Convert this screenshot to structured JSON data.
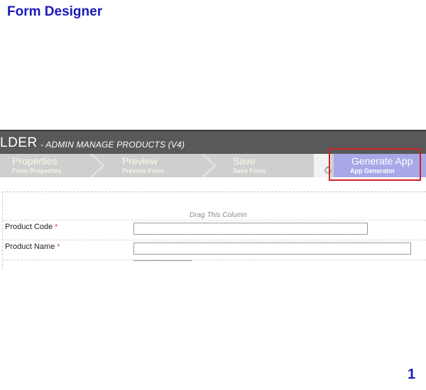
{
  "page": {
    "title": "Form Designer",
    "page_number": "1"
  },
  "builder": {
    "header_main": "LDER",
    "header_sub": "- ADMIN MANAGE PRODUCTS (V4)"
  },
  "toolbar": {
    "items": [
      {
        "label": "Properties",
        "sub": "Form Properties"
      },
      {
        "label": "Preview",
        "sub": "Preview Form"
      },
      {
        "label": "Save",
        "sub": "Save Form"
      },
      {
        "label": "Generate App",
        "sub": "App Generator"
      }
    ],
    "highlight_color": "#cc2222",
    "generate_bg": "#a8a8e8"
  },
  "form": {
    "drag_hint": "Drag This Column",
    "fields": [
      {
        "label": "Product Code",
        "required_mark": "*",
        "value": ""
      },
      {
        "label": "Product Name",
        "required_mark": "*",
        "value": ""
      }
    ]
  },
  "colors": {
    "title": "#1a1ab8",
    "header_bg": "#595959",
    "toolbar_bg": "#cfcfcf",
    "required": "#d23030"
  }
}
